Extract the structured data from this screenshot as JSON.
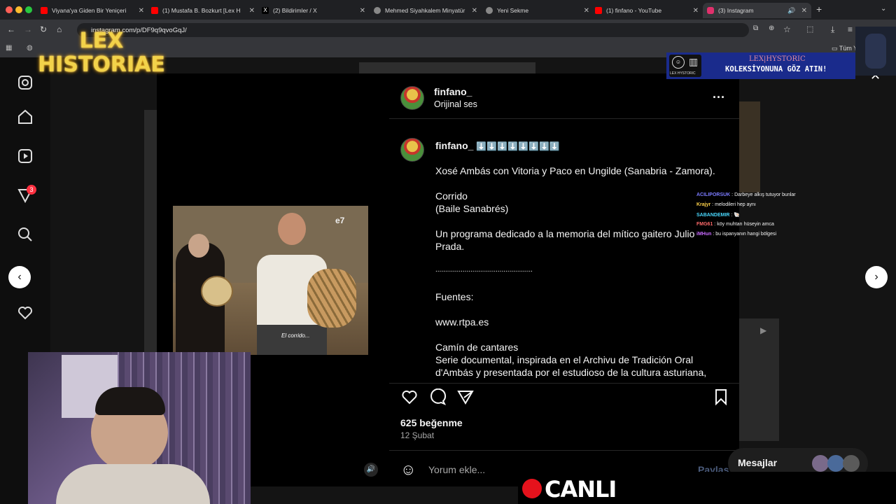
{
  "browser": {
    "tabs": [
      {
        "label": "Viyana'ya Giden Bir Yeniçeri",
        "color": "#ff0000"
      },
      {
        "label": "(1) Mustafa B. Bozkurt [Lex H",
        "color": "#ff0000"
      },
      {
        "label": "(2) Bildirimler / X",
        "color": "#ffffff"
      },
      {
        "label": "Mehmed Siyahkalem Minyatür",
        "color": "#888888"
      },
      {
        "label": "Yeni Sekme",
        "color": "#888888"
      },
      {
        "label": "(1) finfano - YouTube",
        "color": "#ff0000"
      },
      {
        "label": "(3) Instagram",
        "color": "#e1306c"
      }
    ],
    "url": "instagram.com/p/DF9q9qvoGqJ/",
    "bookmarks_right": "Tüm Y"
  },
  "sidebar": {
    "badge": "3"
  },
  "post": {
    "username": "finfano_",
    "audio": "Orijinal ses",
    "caption_user": "finfano_",
    "caption_emoji": "⬇️⬇️⬇️⬇️⬇️⬇️⬇️⬇️",
    "lines": [
      "Xosé Ambás con Vitoria y Paco en Ungilde (Sanabria - Zamora).",
      "Corrido",
      "(Baile Sanabrés)",
      "Un programa dedicado a la memoria del mítico gaitero Julio",
      "Prada.",
      "..................................................",
      "Fuentes:",
      "www.rtpa.es",
      "Camín de cantares",
      "Serie documental, inspirada en el Archivu de Tradición Oral",
      "d'Ambás y presentada por el estudioso de la cultura asturiana,"
    ],
    "likes": "625 beğenme",
    "date": "12 Şubat",
    "comment_placeholder": "Yorum ekle...",
    "share_label": "Paylaş",
    "messages_label": "Mesajlar"
  },
  "video": {
    "watermark": "e7",
    "subtitle": "El corrido..."
  },
  "overlay": {
    "logo_line1": "LEX",
    "logo_line2": "HISTORIAE",
    "banner_brand": "LEX|HYSTORIC",
    "banner_text": "KOLEKSİYONUNA GÖZ ATIN!",
    "banner_logo_text": "LEX HYSTORIC",
    "live": "CANLI",
    "chat": [
      {
        "user": "ACILIPORSUK",
        "color": "#7b7bff",
        "msg": "Darbeye alkış tutuyor bunlar"
      },
      {
        "user": "Krajyr",
        "color": "#ffd24a",
        "msg": "melodileri hep aynı"
      },
      {
        "user": "SABANDEMIR",
        "color": "#4ad9ff",
        "msg": "🐚"
      },
      {
        "user": "FMG61",
        "color": "#ff6a6a",
        "msg": "köy muhtarı hüseyin amca"
      },
      {
        "user": "iMHun",
        "color": "#c86aff",
        "msg": "bu ispanyanın hangi bölgesi"
      }
    ]
  }
}
